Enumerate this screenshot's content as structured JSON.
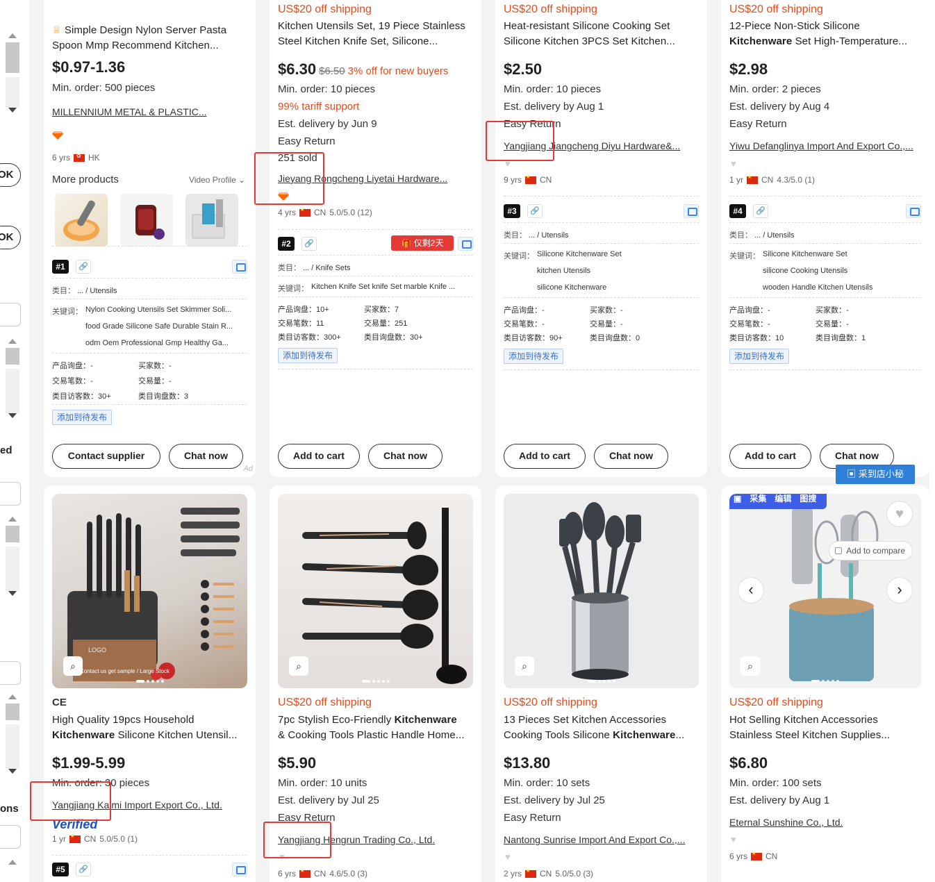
{
  "sidebar": {
    "ok1": "OK",
    "ok2": "OK",
    "ed_label": "ed",
    "ons_label": "ons"
  },
  "cards": [
    {
      "title_lines": [
        "Simple Design Nylon Server Pasta",
        "Spoon Mmp Recommend Kitchen..."
      ],
      "price": "$0.97-1.36",
      "moq": "Min. order: 500 pieces",
      "supplier": "MILLENNIUM METAL & PLASTIC...",
      "years": "6 yrs",
      "country": "HK",
      "more_products": "More products",
      "video_profile": "Video Profile",
      "rank": "#1",
      "category_label": "类目：",
      "category": "... / Utensils",
      "keywords_label": "关键词：",
      "keywords": [
        "Nylon Cooking Utensils Set Skimmer Soli...",
        "food Grade Silicone Safe Durable Stain R...",
        "odm Oem Professional Gmp Healthy Ga..."
      ],
      "stats": [
        [
          "产品询盘：",
          "-"
        ],
        [
          "买家数：",
          "-"
        ],
        [
          "交易笔数：",
          "-"
        ],
        [
          "交易量：",
          "-"
        ],
        [
          "类目访客数：",
          "30+"
        ],
        [
          "类目询盘数：",
          "3"
        ]
      ],
      "add_publish": "添加到待发布",
      "btn1": "Contact supplier",
      "btn2": "Chat now",
      "ad": "Ad"
    },
    {
      "shipping": "US$20 off shipping",
      "title_lines": [
        "Kitchen Utensils Set, 19 Piece Stainless",
        "Steel Kitchen Knife Set, Silicone..."
      ],
      "price": "$6.30",
      "old_price": "$6.50",
      "discount": "3% off for new buyers",
      "moq": "Min. order: 10 pieces",
      "tariff": "99% tariff support",
      "delivery": "Est. delivery by Jun 9",
      "easy_return": "Easy Return",
      "sold": "251 sold",
      "supplier": "Jieyang Rongcheng Liyetai Hardware...",
      "years": "4 yrs",
      "country": "CN",
      "rating": "5.0/5.0 (12)",
      "rank": "#2",
      "promo": "仅剩2天",
      "category_label": "类目：",
      "category": "... / Knife Sets",
      "keywords_label": "关键词：",
      "keywords": [
        "Kitchen Knife Set knife Set marble Knife ..."
      ],
      "stats": [
        [
          "产品询盘：",
          "10+"
        ],
        [
          "买家数：",
          "7"
        ],
        [
          "交易笔数：",
          "11"
        ],
        [
          "交易量：",
          "251"
        ],
        [
          "类目访客数：",
          "300+"
        ],
        [
          "类目询盘数：",
          "30+"
        ]
      ],
      "add_publish": "添加到待发布",
      "btn1": "Add to cart",
      "btn2": "Chat now"
    },
    {
      "shipping": "US$20 off shipping",
      "title_lines": [
        "Heat-resistant Silicone Cooking Set",
        "Silicone Kitchen 3PCS Set Kitchen..."
      ],
      "price": "$2.50",
      "moq": "Min. order: 10 pieces",
      "delivery": "Est. delivery by Aug 1",
      "easy_return": "Easy Return",
      "supplier": "Yangjiang Jiangcheng Diyu Hardware&...",
      "years": "9 yrs",
      "country": "CN",
      "rank": "#3",
      "category_label": "类目：",
      "category": "... / Utensils",
      "keywords_label": "关键词：",
      "keywords": [
        "Silicone Kitchenware Set",
        "kitchen Utensils",
        "silicone Kitchenware"
      ],
      "stats": [
        [
          "产品询盘：",
          "-"
        ],
        [
          "买家数：",
          "-"
        ],
        [
          "交易笔数：",
          "-"
        ],
        [
          "交易量：",
          "-"
        ],
        [
          "类目访客数：",
          "90+"
        ],
        [
          "类目询盘数：",
          "0"
        ]
      ],
      "add_publish": "添加到待发布",
      "btn1": "Add to cart",
      "btn2": "Chat now"
    },
    {
      "shipping": "US$20 off shipping",
      "title_lines": [
        "12-Piece Non-Stick Silicone",
        "Set High-Temperature..."
      ],
      "title_bold": "Kitchenware",
      "price": "$2.98",
      "moq": "Min. order: 2 pieces",
      "delivery": "Est. delivery by Aug 4",
      "easy_return": "Easy Return",
      "supplier": "Yiwu Defanglinya Import And Export Co.,...",
      "years": "1 yr",
      "country": "CN",
      "rating": "4.3/5.0 (1)",
      "rank": "#4",
      "category_label": "类目：",
      "category": "... / Utensils",
      "keywords_label": "关键词：",
      "keywords": [
        "Silicone Kitchenware Set",
        "silicone Cooking Utensils",
        "wooden Handle Kitchen Utensils"
      ],
      "stats": [
        [
          "产品询盘：",
          "-"
        ],
        [
          "买家数：",
          "-"
        ],
        [
          "交易笔数：",
          "-"
        ],
        [
          "交易量：",
          "-"
        ],
        [
          "类目访客数：",
          "10"
        ],
        [
          "类目询盘数：",
          "1"
        ]
      ],
      "add_publish": "添加到待发布",
      "btn1": "Add to cart",
      "btn2": "Chat now",
      "assistant": "采到店小秘"
    },
    {
      "title_lines": [
        "High Quality 19pcs Household",
        "Silicone Kitchen Utensil..."
      ],
      "title_bold": "Kitchenware",
      "ce": "CE",
      "logo_text": "LOGO",
      "img_caption": "Contact us get sample / Large Stock",
      "price": "$1.99-5.99",
      "moq": "Min. order: 30 pieces",
      "supplier": "Yangjiang Kaimi Import Export Co., Ltd.",
      "verified": "Verified",
      "years": "1 yr",
      "country": "CN",
      "rating": "5.0/5.0 (1)",
      "rank": "#5"
    },
    {
      "shipping": "US$20 off shipping",
      "title_lines": [
        "7pc Stylish Eco-Friendly",
        "& Cooking Tools Plastic Handle Home..."
      ],
      "title_bold": "Kitchenware",
      "price": "$5.90",
      "moq": "Min. order: 10 units",
      "delivery": "Est. delivery by Jul 25",
      "easy_return": "Easy Return",
      "supplier": "Yangjiang Hengrun Trading Co., Ltd.",
      "years": "6 yrs",
      "country": "CN",
      "rating": "4.6/5.0 (3)"
    },
    {
      "shipping": "US$20 off shipping",
      "title_lines": [
        "13 Pieces Set Kitchen Accessories",
        "Cooking Tools Silicone"
      ],
      "title_bold": "Kitchenware",
      "price": "$13.80",
      "moq": "Min. order: 10 sets",
      "delivery": "Est. delivery by Jul 25",
      "easy_return": "Easy Return",
      "supplier": "Nantong Sunrise Import And Export Co.,...",
      "years": "2 yrs",
      "country": "CN",
      "rating": "5.0/5.0 (3)"
    },
    {
      "shipping": "US$20 off shipping",
      "title_lines": [
        "Hot Selling Kitchen Accessories",
        "Stainless Steel Kitchen Supplies..."
      ],
      "price": "$6.80",
      "moq": "Min. order: 100 sets",
      "delivery": "Est. delivery by Aug 1",
      "supplier": "Eternal Sunshine Co., Ltd.",
      "years": "6 yrs",
      "country": "CN",
      "toolbar": [
        "采集",
        "编辑",
        "图搜"
      ],
      "compare": "Add to compare"
    }
  ],
  "colors": {
    "accent_orange": "#e64a19",
    "highlight_red": "#e53935",
    "link_blue": "#3b6fd0"
  }
}
